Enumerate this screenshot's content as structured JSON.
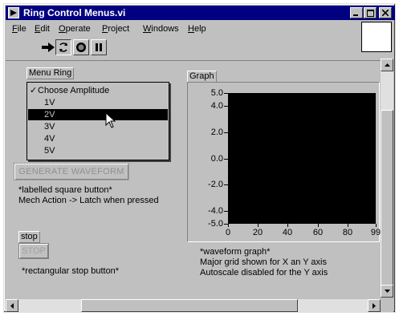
{
  "window": {
    "title": "Ring Control Menus.vi"
  },
  "menubar": {
    "items": [
      {
        "label": "File"
      },
      {
        "label": "Edit"
      },
      {
        "label": "Operate"
      },
      {
        "label": "Project"
      },
      {
        "label": "Windows"
      },
      {
        "label": "Help"
      }
    ]
  },
  "toolbar": {
    "icons": [
      "run-arrow-icon",
      "run-continuously-icon",
      "abort-icon",
      "pause-icon"
    ]
  },
  "menu_ring": {
    "label": "Menu Ring",
    "items": [
      {
        "label": "Choose Amplitude",
        "checked": true
      },
      {
        "label": "1V"
      },
      {
        "label": "2V",
        "highlighted": true
      },
      {
        "label": "3V"
      },
      {
        "label": "4V"
      },
      {
        "label": "5V"
      }
    ]
  },
  "generate_button": {
    "label": "GENERATE WAVEFORM",
    "note_line1": "*labelled square button*",
    "note_line2": "Mech Action -> Latch when pressed"
  },
  "stop": {
    "label": "stop",
    "button_label": "STOP",
    "note": "*rectangular stop button*"
  },
  "graph": {
    "label": "Graph",
    "note_line1": "*waveform graph*",
    "note_line2": "Major grid shown for X an Y axis",
    "note_line3": "Autoscale disabled for the Y axis",
    "y_ticks": [
      "5.0",
      "4.0",
      "2.0",
      "0.0",
      "-2.0",
      "-4.0",
      "-5.0"
    ],
    "x_ticks": [
      "0",
      "20",
      "40",
      "60",
      "80",
      "99"
    ]
  },
  "chart_data": {
    "type": "line",
    "series": [],
    "ylim": [
      -5.0,
      5.0
    ],
    "xlim": [
      0,
      99
    ],
    "y_tick_values": [
      5.0,
      4.0,
      2.0,
      0.0,
      -2.0,
      -4.0,
      -5.0
    ],
    "x_tick_values": [
      0,
      20,
      40,
      60,
      80,
      99
    ],
    "grid": false,
    "background": "#000000"
  },
  "colors": {
    "titlebar": "#000080",
    "panel": "#c0c0c0",
    "plot_bg": "#000000",
    "highlight": "#000000"
  }
}
